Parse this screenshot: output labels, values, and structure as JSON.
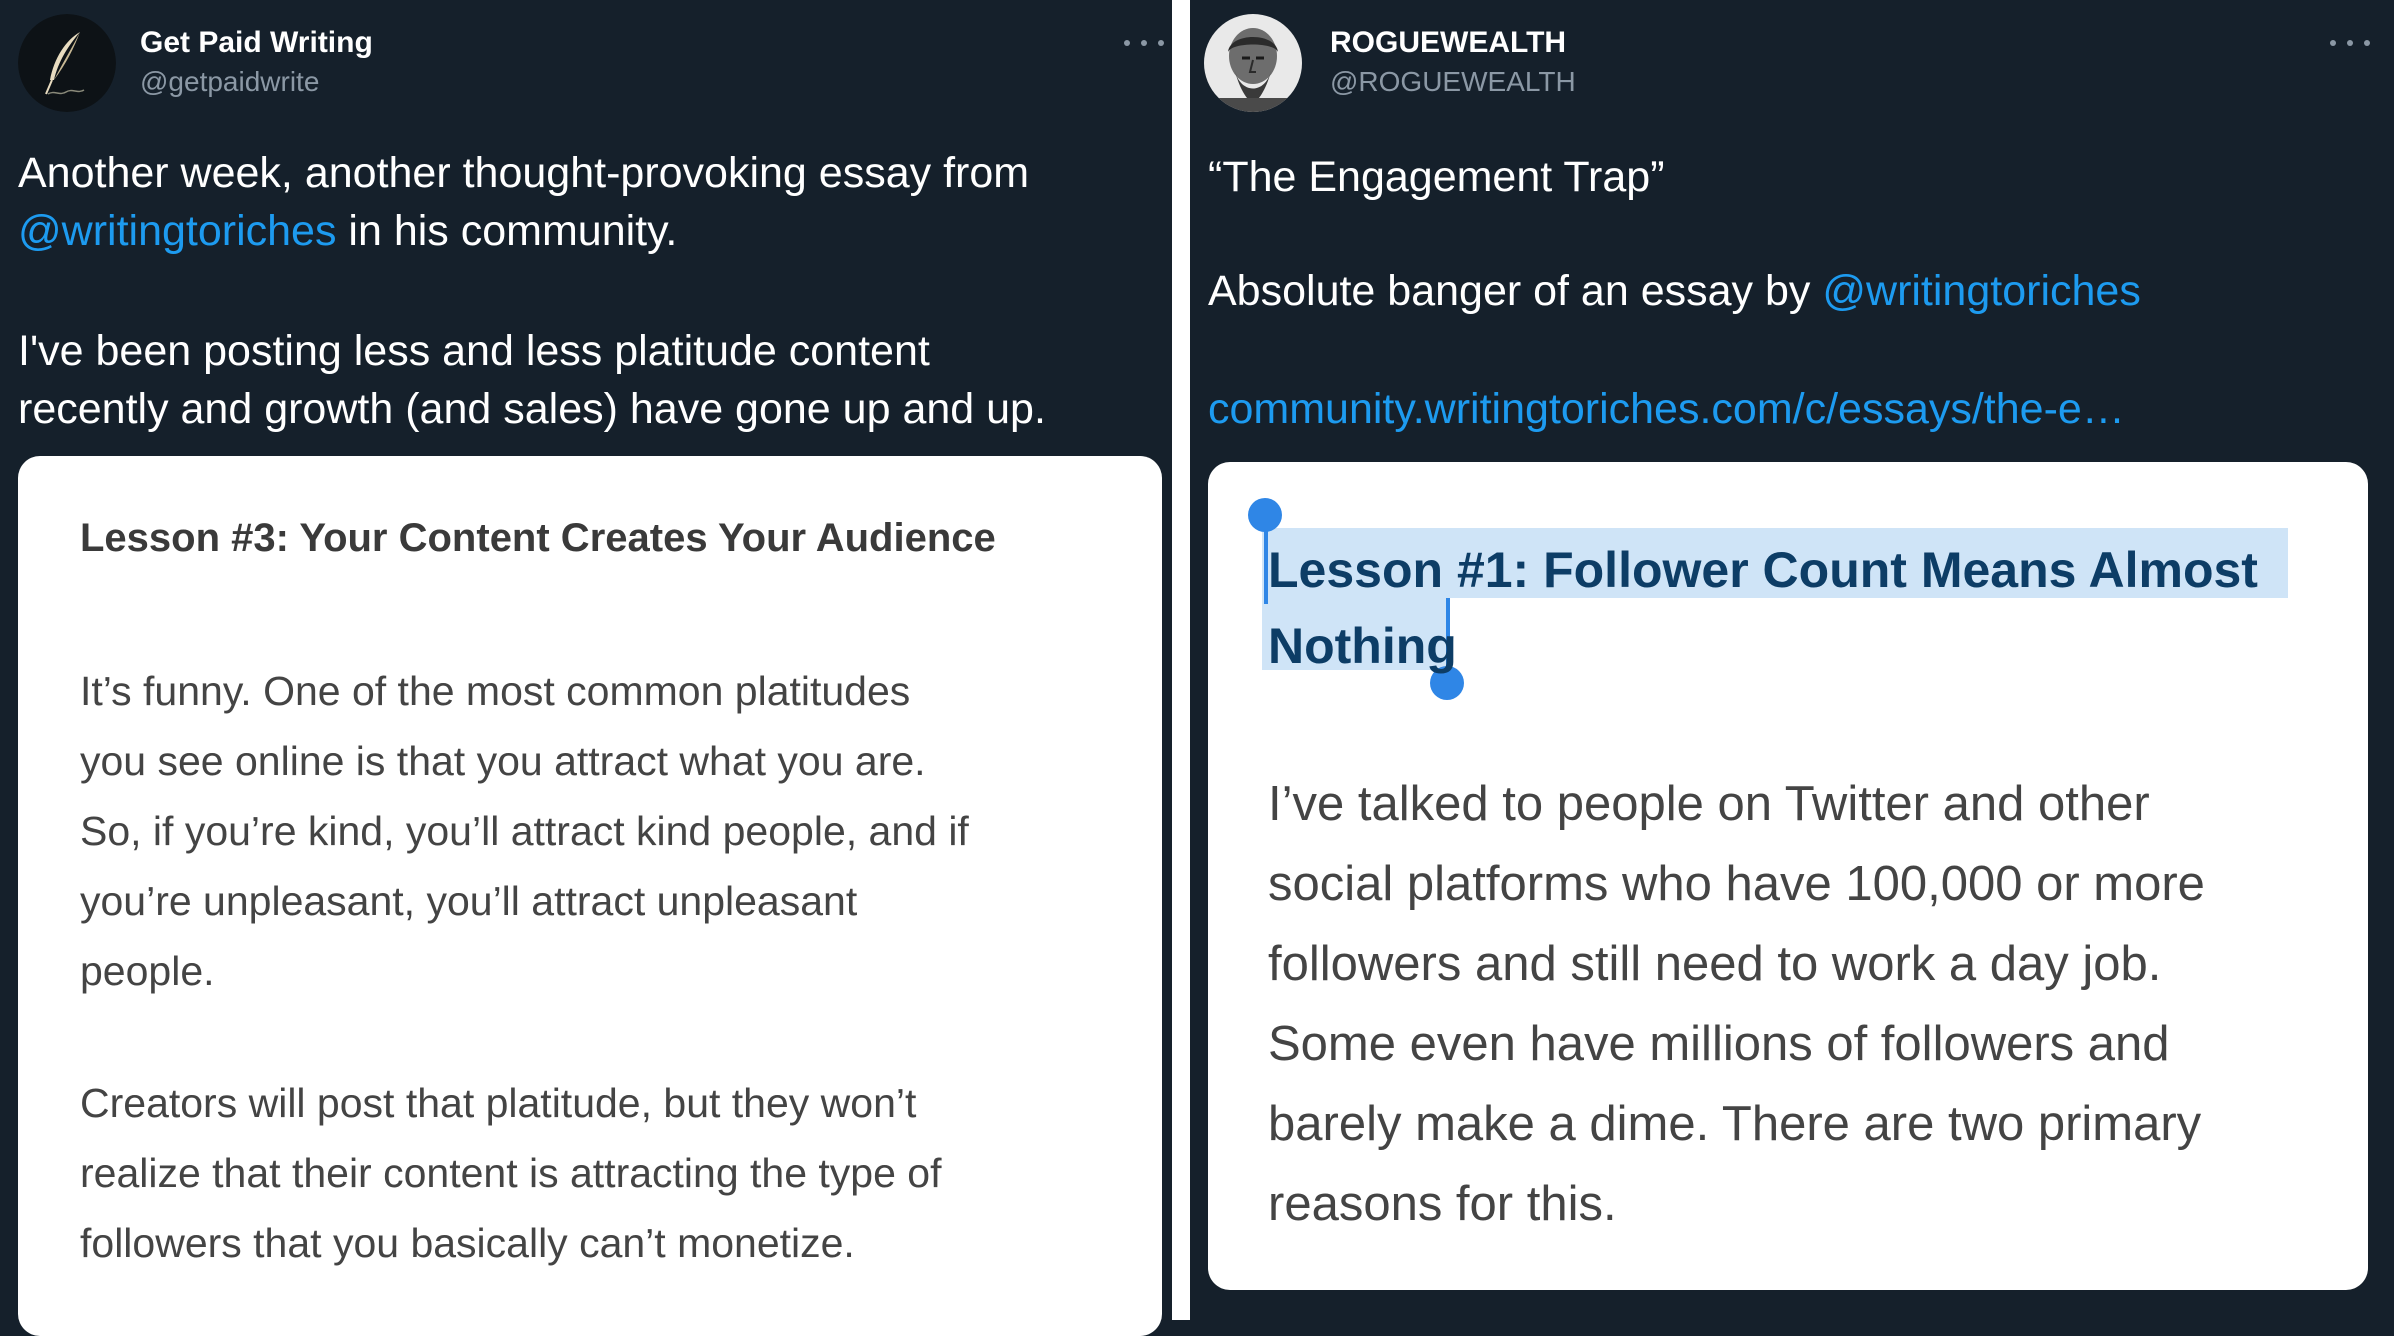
{
  "left_tweet": {
    "display_name": "Get Paid Writing",
    "handle": "@getpaidwrite",
    "avatar_icon": "quill-icon",
    "text_lines": [
      {
        "before": "Another week, another thought-provoking essay from",
        "link": "",
        "after": ""
      },
      {
        "before": "",
        "link": "@writingtoriches",
        "after": " in his community."
      },
      {
        "before": "",
        "link": "",
        "after": ""
      },
      {
        "before": "I've been posting less and less platitude content",
        "link": "",
        "after": ""
      },
      {
        "before": "recently and growth (and sales) have gone up and up.",
        "link": "",
        "after": ""
      }
    ],
    "card": {
      "title": "Lesson #3: Your Content Creates Your Audience",
      "paragraph1": [
        "It’s funny. One of the most common platitudes",
        "you see online is that you attract what you are.",
        "So, if you’re kind, you’ll attract kind people, and if",
        "you’re unpleasant, you’ll attract unpleasant",
        "people."
      ],
      "paragraph2": [
        "Creators will post that platitude, but they won’t",
        "realize that their content is attracting the type of",
        "followers that you basically can’t monetize."
      ]
    }
  },
  "right_tweet": {
    "display_name": "ROGUEWEALTH",
    "handle": "@ROGUEWEALTH",
    "avatar_icon": "statue-head-icon",
    "quote_title": "“The Engagement Trap”",
    "line2_prefix": "Absolute banger of an essay by ",
    "line2_link": "@writingtoriches",
    "url_text": "community.writingtoriches.com/c/essays/the-e…",
    "card": {
      "title_line1": "Lesson #1: Follower Count Means Almost",
      "title_line2": "Nothing",
      "body": [
        "I’ve talked to people on Twitter and other",
        "social platforms who have 100,000 or more",
        "followers and still need to work a day job.",
        "Some even have millions of followers and",
        "barely make a dime. There are two primary",
        "reasons for this."
      ]
    }
  },
  "colors": {
    "background": "#15202b",
    "link": "#1d9bf0",
    "muted": "#8b98a5",
    "selection": "#cfe4f7",
    "selection_handle": "#2f86e6"
  }
}
